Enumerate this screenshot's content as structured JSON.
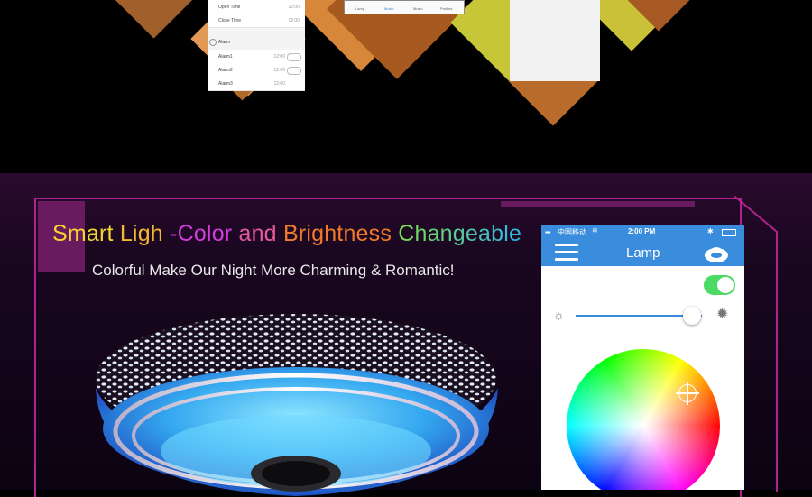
{
  "top_panel": {
    "schedule_rows": [
      {
        "label": "Open Time",
        "value": "12:00"
      },
      {
        "label": "Close Time",
        "value": "12:00"
      }
    ],
    "alarm_header": "Alarm",
    "alarm_rows": [
      {
        "label": "Alarm1",
        "value": "12:00"
      },
      {
        "label": "Alarm2",
        "value": "12:00"
      },
      {
        "label": "Alarm3",
        "value": "12:00"
      }
    ],
    "tab_bar": [
      "Lamp",
      "Music",
      "Music",
      "Profiles"
    ]
  },
  "headline": {
    "words": [
      {
        "text": "Smart",
        "color": "#f5d630"
      },
      {
        "text": " Ligh",
        "color": "#f3b72e"
      },
      {
        "text": " -Color",
        "color": "#d63be0"
      },
      {
        "text": " and",
        "color": "#e35a9c"
      },
      {
        "text": " Brightness",
        "color": "#f07a2a"
      },
      {
        "text": " Changeable",
        "color": "#7ee04a"
      }
    ],
    "last_word": {
      "text": "Changeable",
      "color": "#2fb7e8"
    }
  },
  "subheadline": "Colorful Make Our Night More Charming & Romantic!",
  "phone": {
    "carrier": "中国移动",
    "time": "2:00 PM",
    "title": "Lamp",
    "power_on": true,
    "brightness_fraction": 0.92,
    "accent": "#3a8ddc",
    "toggle_color": "#4cd964"
  },
  "icons": [
    "menu-icon",
    "speaker-lamp-icon",
    "sun-dim-icon",
    "sun-bright-icon",
    "wifi-icon",
    "bluetooth-icon",
    "battery-icon",
    "crosshair-icon"
  ]
}
